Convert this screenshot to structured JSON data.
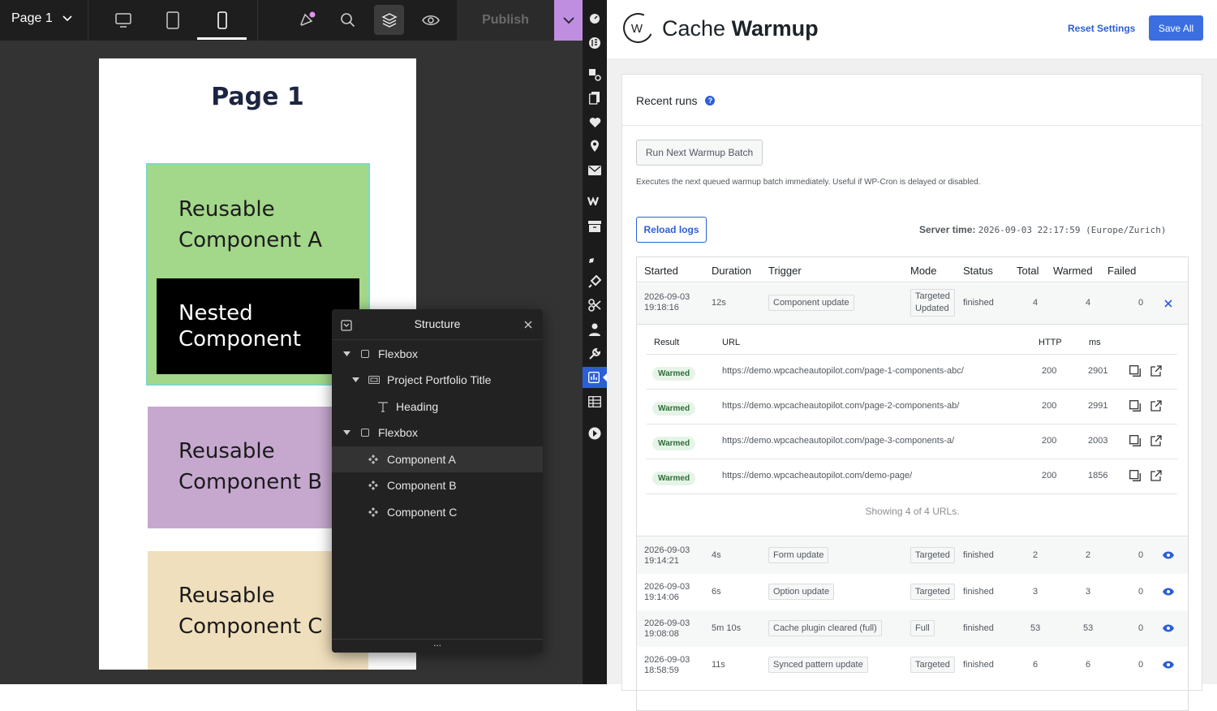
{
  "topbar": {
    "page_name": "Page 1",
    "publish_label": "Publish"
  },
  "canvas": {
    "page_title": "Page 1",
    "comp_a": "Reusable\nComponent A",
    "nested": "Nested\nComponent",
    "comp_b": "Reusable\nComponent B",
    "comp_c": "Reusable\nComponent C"
  },
  "structure": {
    "title": "Structure",
    "items": [
      {
        "label": "Flexbox"
      },
      {
        "label": "Project Portfolio Title"
      },
      {
        "label": "Heading"
      },
      {
        "label": "Flexbox"
      },
      {
        "label": "Component A"
      },
      {
        "label": "Component B"
      },
      {
        "label": "Component C"
      }
    ],
    "footer": "..."
  },
  "admin": {
    "title_light": "Cache ",
    "title_bold": "Warmup",
    "logo_letter": "W",
    "reset_label": "Reset Settings",
    "save_label": "Save All",
    "section_title": "Recent runs",
    "run_next_label": "Run Next Warmup Batch",
    "run_next_desc": "Executes the next queued warmup batch immediately. Useful if WP-Cron is delayed or disabled.",
    "reload_label": "Reload logs",
    "server_time_label": "Server time:",
    "server_time_value": "2026-09-03 22:17:59 (Europe/Zurich)",
    "columns": [
      "Started",
      "Duration",
      "Trigger",
      "Mode",
      "Status",
      "Total",
      "Warmed",
      "Failed"
    ],
    "expanded_run": {
      "date": "2026-09-03",
      "time": "19:18:16",
      "duration": "12s",
      "trigger": "Component update",
      "mode_line1": "Targeted",
      "mode_line2": "Updated",
      "status": "finished",
      "total": "4",
      "warmed": "4",
      "failed": "0"
    },
    "result_columns": [
      "Result",
      "URL",
      "HTTP",
      "ms"
    ],
    "results": [
      {
        "result": "Warmed",
        "url": "https://demo.wpcacheautopilot.com/page-1-components-abc/",
        "http": "200",
        "ms": "2901"
      },
      {
        "result": "Warmed",
        "url": "https://demo.wpcacheautopilot.com/page-2-components-ab/",
        "http": "200",
        "ms": "2991"
      },
      {
        "result": "Warmed",
        "url": "https://demo.wpcacheautopilot.com/page-3-components-a/",
        "http": "200",
        "ms": "2003"
      },
      {
        "result": "Warmed",
        "url": "https://demo.wpcacheautopilot.com/demo-page/",
        "http": "200",
        "ms": "1856"
      }
    ],
    "showing": "Showing 4 of 4 URLs.",
    "runs": [
      {
        "date": "2026-09-03",
        "time": "19:14:21",
        "duration": "4s",
        "trigger": "Form update",
        "mode": "Targeted",
        "status": "finished",
        "total": "2",
        "warmed": "2",
        "failed": "0"
      },
      {
        "date": "2026-09-03",
        "time": "19:14:06",
        "duration": "6s",
        "trigger": "Option update",
        "mode": "Targeted",
        "status": "finished",
        "total": "3",
        "warmed": "3",
        "failed": "0"
      },
      {
        "date": "2026-09-03",
        "time": "19:08:08",
        "duration": "5m 10s",
        "trigger": "Cache plugin cleared (full)",
        "mode": "Full",
        "status": "finished",
        "total": "53",
        "warmed": "53",
        "failed": "0"
      },
      {
        "date": "2026-09-03",
        "time": "18:58:59",
        "duration": "11s",
        "trigger": "Synced pattern update",
        "mode": "Targeted",
        "status": "finished",
        "total": "6",
        "warmed": "6",
        "failed": "0"
      }
    ]
  },
  "colors": {
    "accent": "#2c5fd6",
    "save_bg": "#3b6fe0",
    "comp_a": "#a3d78a",
    "comp_b": "#c6a8cf",
    "comp_c": "#f0dfbd",
    "purple": "#c08ee0"
  }
}
